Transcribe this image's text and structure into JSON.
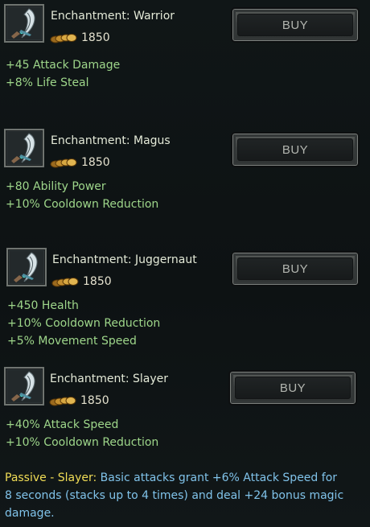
{
  "colors": {
    "title": "#e4ead8",
    "stat_green": "#9ed68a",
    "passive_blue": "#80c3ea",
    "passive_gold": "#f1dd56",
    "button_text": "#b2b5af"
  },
  "icons": {
    "item": "curved-blade-icon",
    "price": "gold-coins-icon"
  },
  "items": [
    {
      "title": "Enchantment: Warrior",
      "price": "1850",
      "buy_label": "BUY",
      "stats": [
        "+45 Attack Damage",
        "+8% Life Steal"
      ]
    },
    {
      "title": "Enchantment: Magus",
      "price": "1850",
      "buy_label": "BUY",
      "stats": [
        "+80 Ability Power",
        "+10% Cooldown Reduction"
      ]
    },
    {
      "title": "Enchantment: Juggernaut",
      "price": "1850",
      "buy_label": "BUY",
      "stats": [
        "+450 Health",
        "+10% Cooldown Reduction",
        "+5% Movement Speed"
      ]
    },
    {
      "title": "Enchantment: Slayer",
      "price": "1850",
      "buy_label": "BUY",
      "stats": [
        "+40% Attack Speed",
        "+10% Cooldown Reduction"
      ]
    }
  ],
  "passive": {
    "label": "Passive - Slayer:",
    "text": " Basic attacks grant +6% Attack Speed for 8 seconds (stacks up to 4 times) and deal +24 bonus magic damage."
  }
}
